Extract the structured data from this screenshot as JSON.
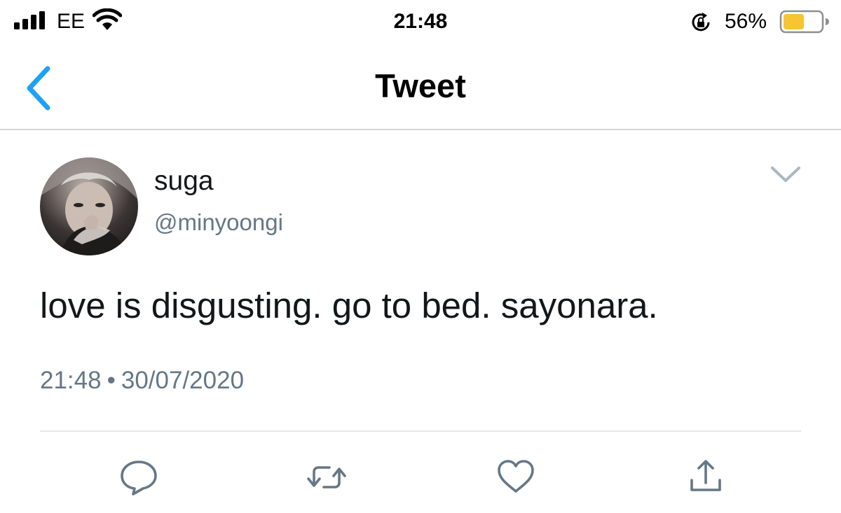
{
  "status_bar": {
    "carrier": "EE",
    "time": "21:48",
    "battery_percent": "56%",
    "battery_level": 0.56,
    "battery_color": "#f5c533",
    "signal_bars_filled": 4,
    "icons": [
      "signal-icon",
      "wifi-icon",
      "rotation-lock-icon",
      "battery-icon"
    ]
  },
  "nav": {
    "back_icon": "chevron-left-icon",
    "title": "Tweet",
    "accent_color": "#1da1f2"
  },
  "tweet": {
    "display_name": "suga",
    "handle": "@minyoongi",
    "text": "love is disgusting. go to bed. sayonara.",
    "time": "21:48",
    "separator": "•",
    "date": "30/07/2020",
    "menu_icon": "chevron-down-icon"
  },
  "actions": [
    {
      "icon": "reply-icon"
    },
    {
      "icon": "retweet-icon"
    },
    {
      "icon": "like-icon"
    },
    {
      "icon": "share-icon"
    }
  ]
}
